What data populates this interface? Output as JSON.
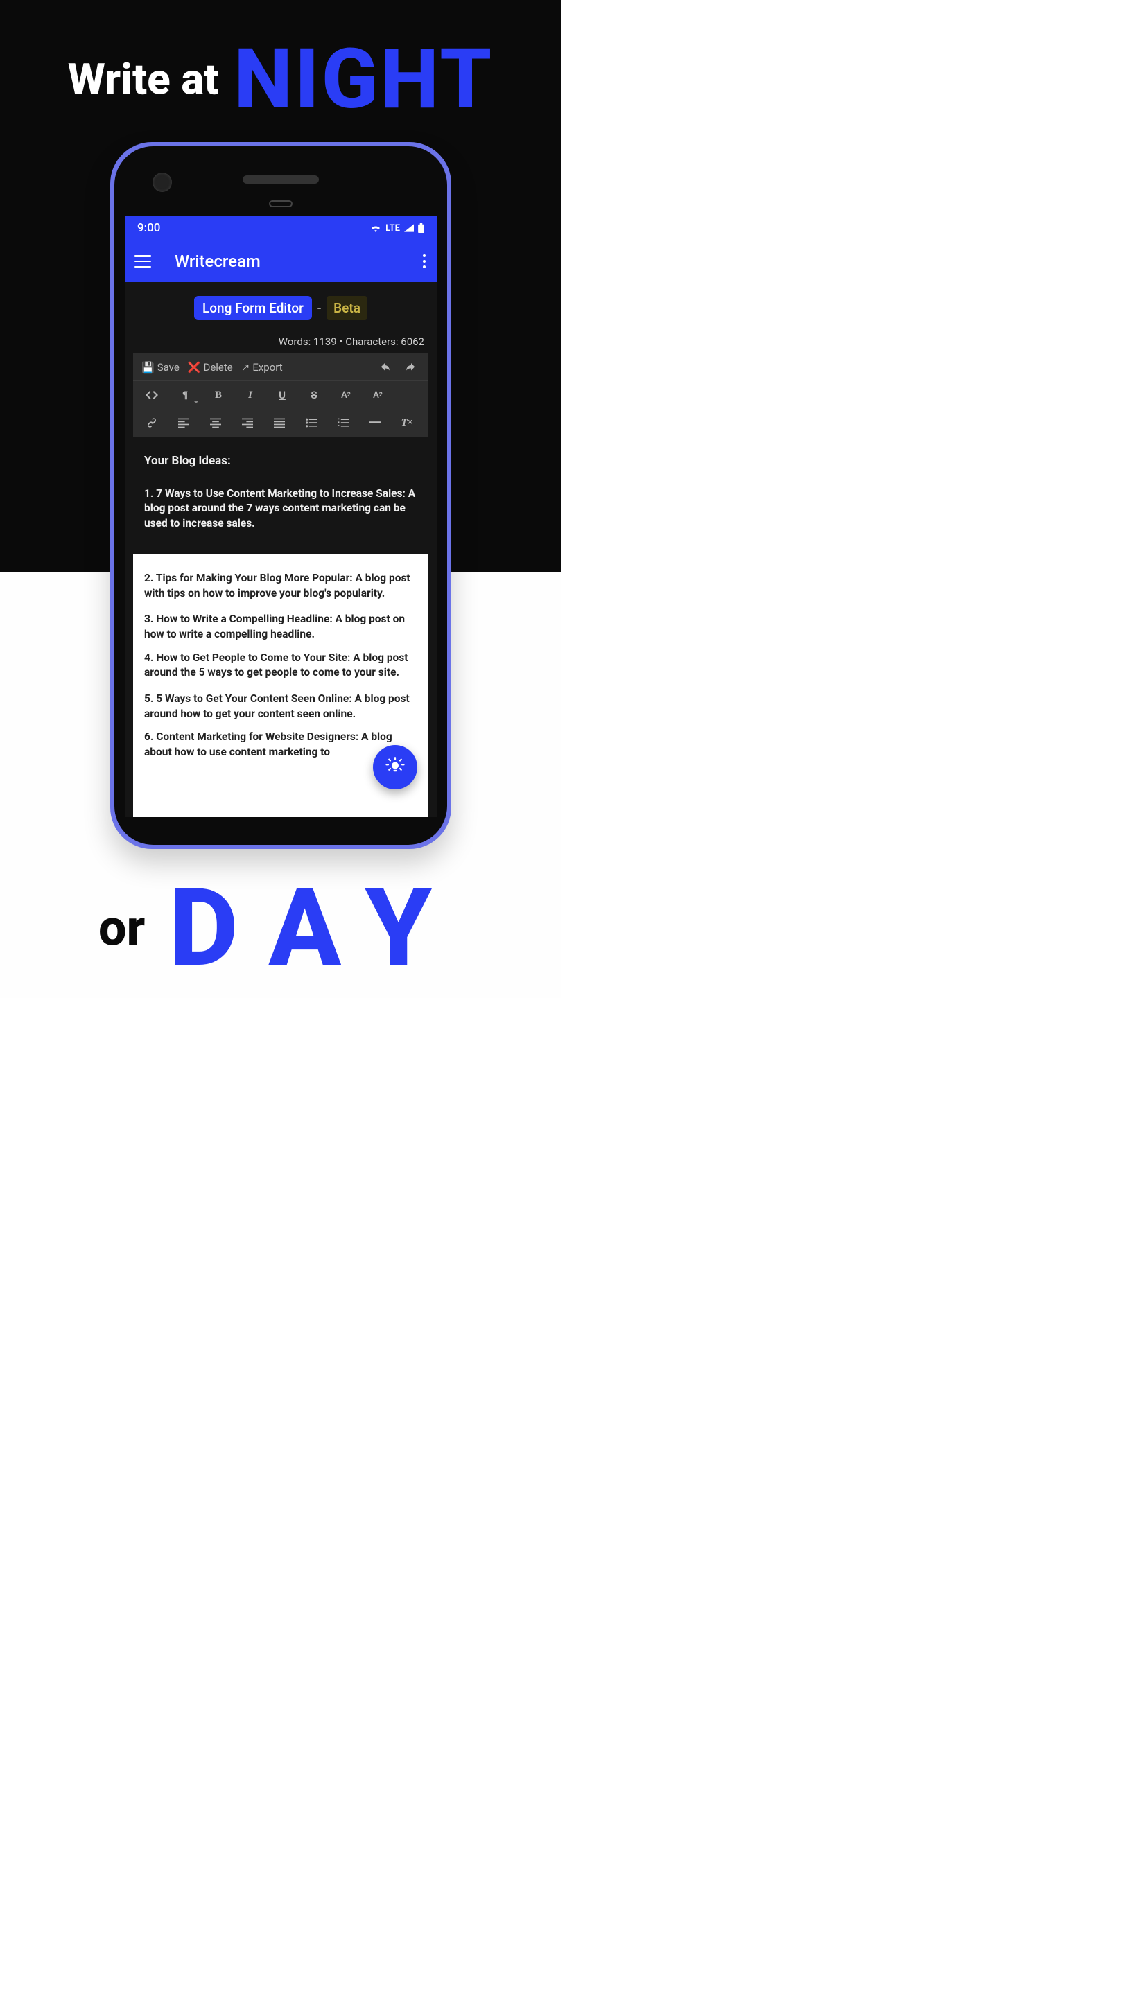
{
  "marketing": {
    "top_white": "Write at",
    "top_blue": "NIGHT",
    "bottom_white": "or",
    "bottom_blue": "DAY"
  },
  "statusbar": {
    "time": "9:00",
    "network": "LTE"
  },
  "appbar": {
    "title": "Writecream"
  },
  "chips": {
    "primary": "Long Form Editor",
    "sep": "-",
    "beta": "Beta"
  },
  "meta": {
    "words_label": "Words:",
    "words": "1139",
    "chars_label": "Characters:",
    "chars": "6062",
    "sep": "•"
  },
  "toolbar": {
    "save": "Save",
    "delete": "Delete",
    "export": "Export",
    "save_icon": "💾",
    "delete_icon": "❌",
    "export_icon": "↗"
  },
  "editor": {
    "title": "Your Blog Ideas:",
    "ideas": [
      "1. 7 Ways to Use Content Marketing to Increase Sales: A blog post around the 7 ways content marketing can be used to increase sales.",
      "2. Tips for Making Your Blog More Popular: A blog post with tips on how to improve your blog's popularity.",
      "3. How to Write a Compelling Headline: A blog post on how to write a compelling headline.",
      "4. How to Get People to Come to Your Site: A blog post around the 5 ways to get people to come to your site.",
      "5. 5 Ways to Get Your Content Seen Online: A blog post around how to get your content seen online.",
      "6. Content Marketing for Website Designers: A blog about how to use content marketing to"
    ]
  }
}
